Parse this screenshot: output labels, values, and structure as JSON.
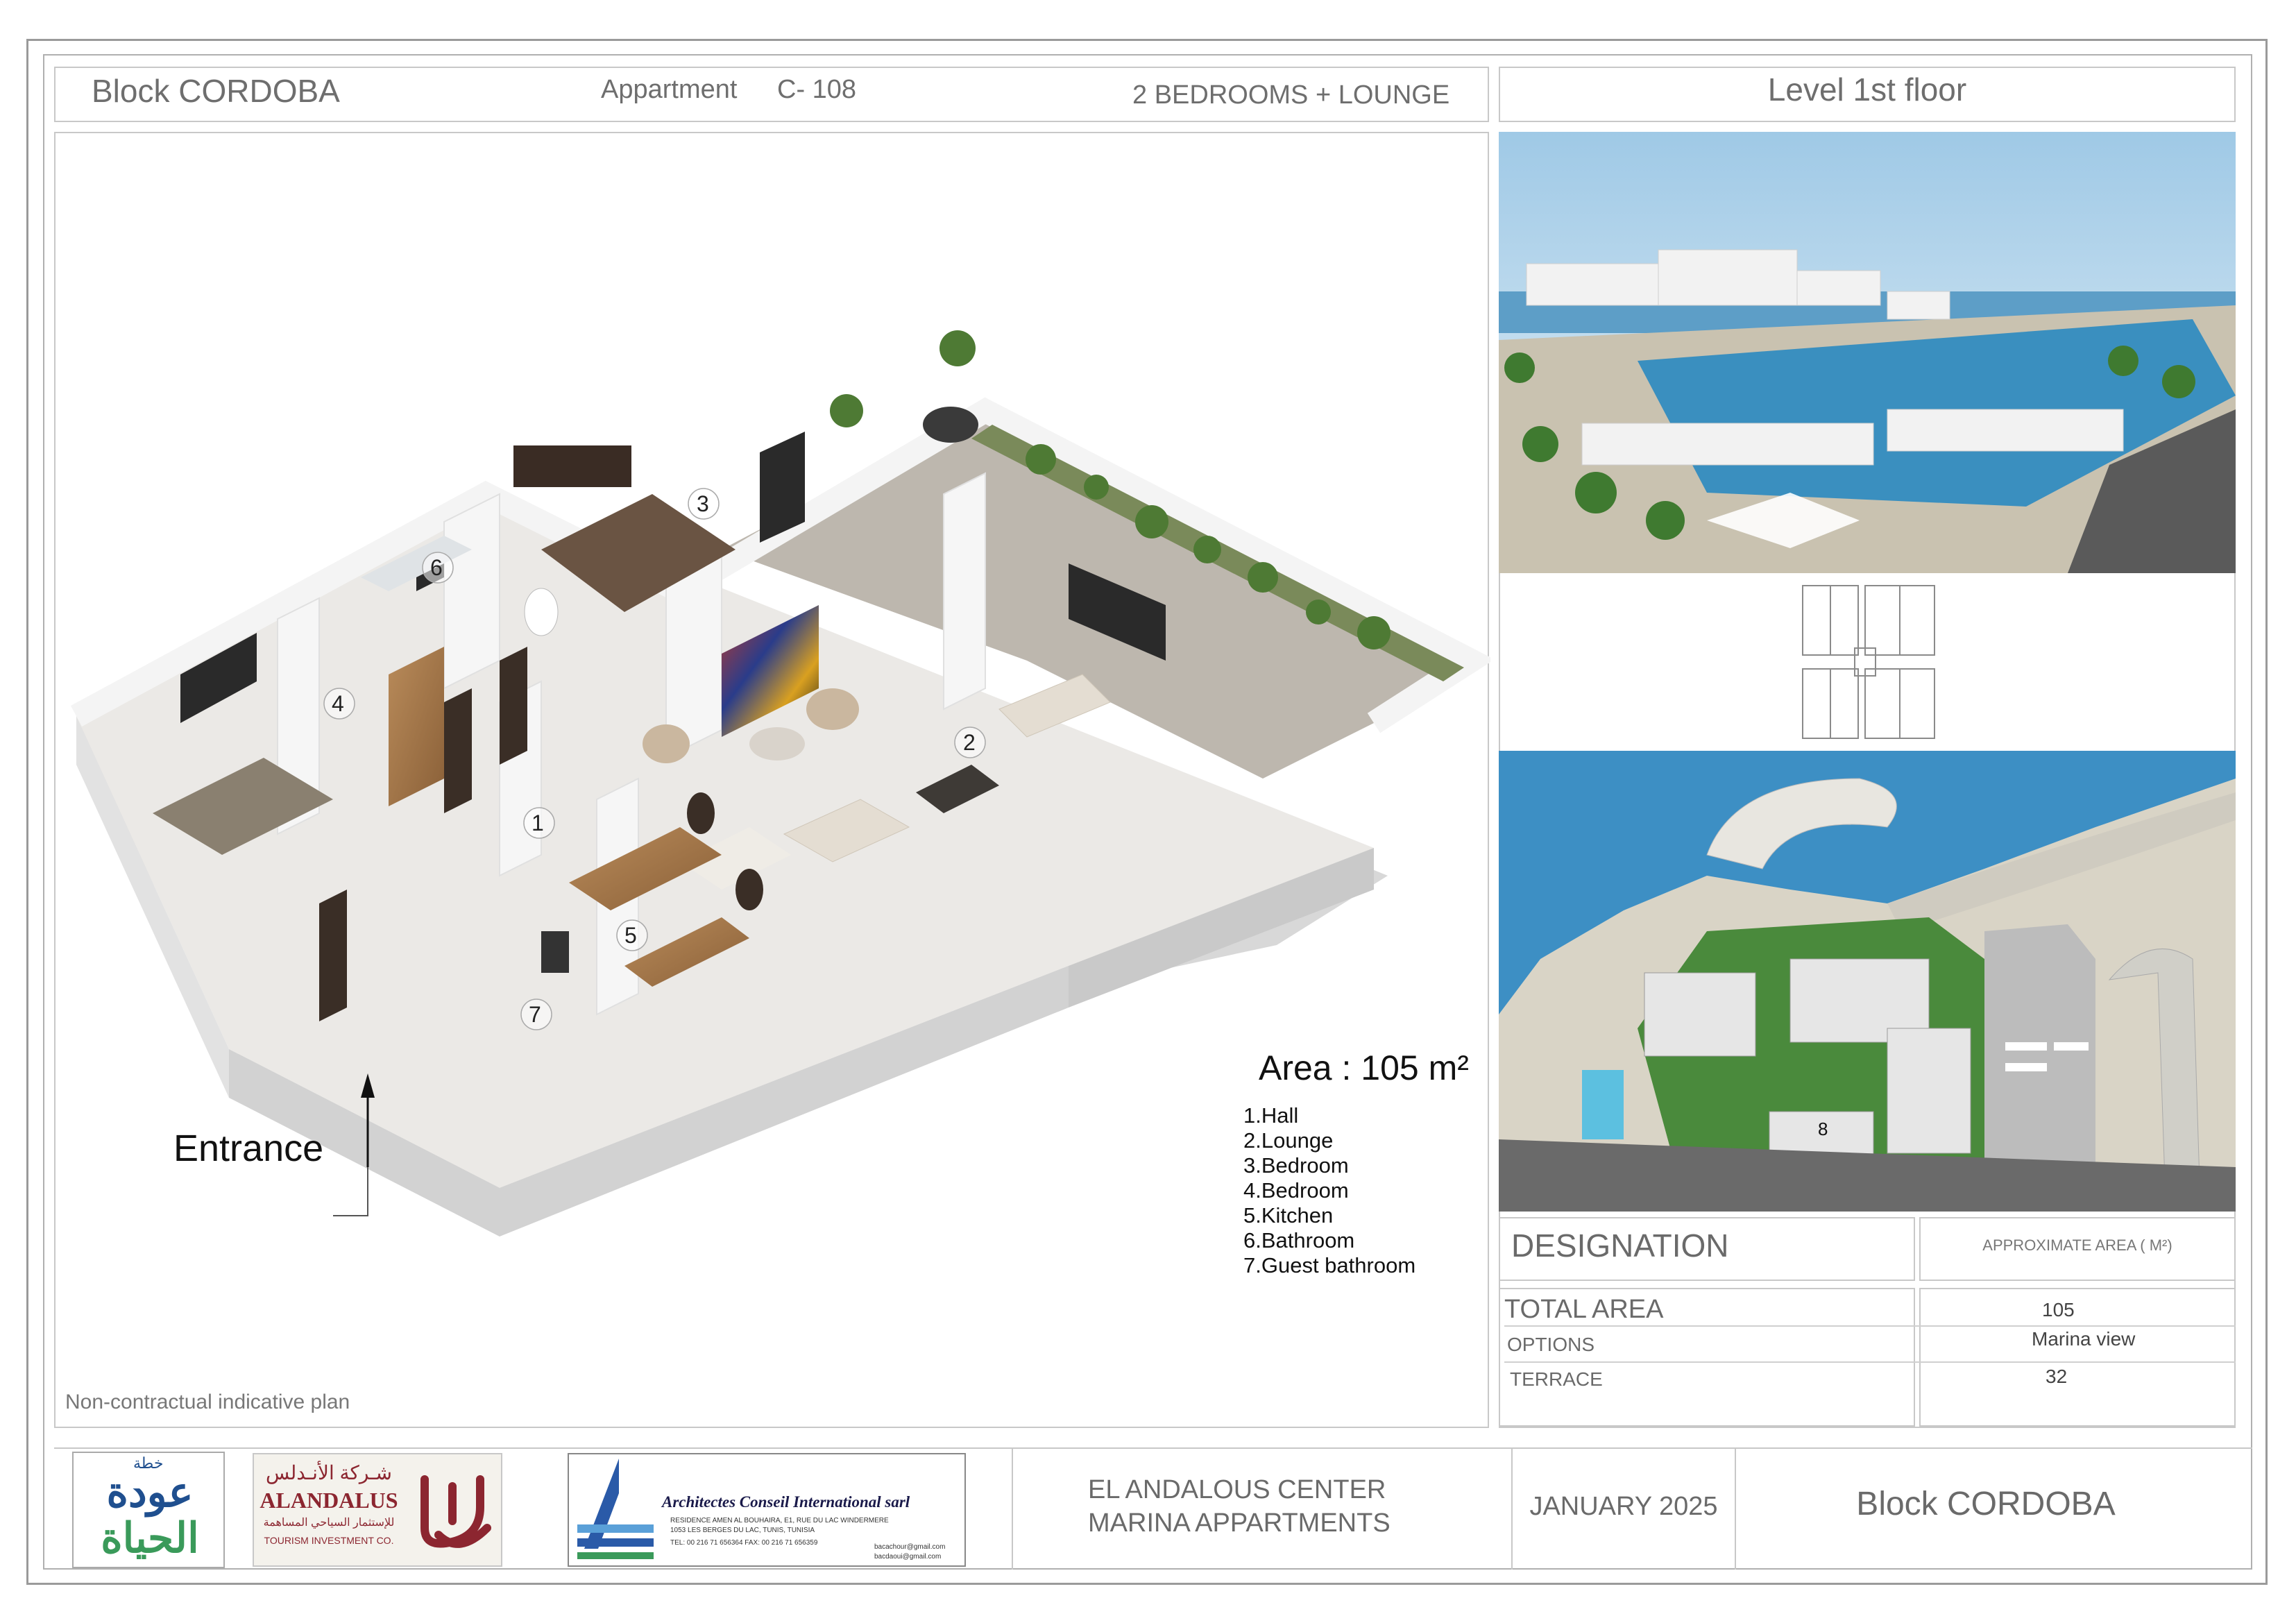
{
  "header": {
    "block": "Block CORDOBA",
    "apartment_label": "Appartment",
    "apartment_code": "C- 108",
    "layout": "2 BEDROOMS + LOUNGE",
    "level": "Level 1st floor"
  },
  "plan": {
    "area": "Area : 105 m²",
    "entrance": "Entrance",
    "disclaimer": "Non-contractual indicative plan",
    "room_numbers": [
      "1",
      "2",
      "3",
      "4",
      "5",
      "6",
      "7"
    ],
    "legend": [
      {
        "num": "1.",
        "name": "Hall"
      },
      {
        "num": "2.",
        "name": "Lounge"
      },
      {
        "num": "3.",
        "name": "Bedroom"
      },
      {
        "num": "4.",
        "name": "Bedroom"
      },
      {
        "num": "5.",
        "name": "Kitchen"
      },
      {
        "num": "6.",
        "name": "Bathroom"
      },
      {
        "num": "7.",
        "name": "Guest bathroom"
      }
    ]
  },
  "site_plan": {
    "block_label": "8"
  },
  "table": {
    "designation_header": "DESIGNATION",
    "area_header": "APPROXIMATE AREA  ( M²)",
    "rows": [
      {
        "label": "TOTAL AREA",
        "value": "105"
      },
      {
        "label": "OPTIONS",
        "value": "Marina view"
      },
      {
        "label": "TERRACE",
        "value": "32"
      }
    ]
  },
  "footer": {
    "logo1_line1": "خطة",
    "logo1_line2": "عودة",
    "logo1_line3": "الحياة",
    "logo2_arabic": "شـركة الأنـدلس",
    "logo2_name": "ALANDALUS",
    "logo2_arabic_sub": "للإستثمار السياحي المساهمة",
    "logo2_sub": "TOURISM INVESTMENT CO.",
    "architect_name": "Architectes  Conseil  International sarl",
    "architect_addr1": "RESIDENCE  AMEN AL BOUHAIRA, E1, RUE DU LAC WINDERMERE",
    "architect_addr2": "1053 LES BERGES DU LAC, TUNIS, TUNISIA",
    "architect_phone": "TEL: 00 216 71 656364   FAX: 00 216 71 656359",
    "architect_email1": "bacachour@gmail.com",
    "architect_email2": "bacdaoui@gmail.com",
    "project_line1": "EL ANDALOUS CENTER",
    "project_line2": "MARINA APPARTMENTS",
    "date": "JANUARY  2025",
    "block": "Block  CORDOBA"
  },
  "colors": {
    "logo_blue": "#1f4f8f",
    "logo_green": "#3a9a5a",
    "logo_maroon": "#8c2630",
    "sea": "#2f7fb8",
    "green": "#3f8a3a"
  }
}
